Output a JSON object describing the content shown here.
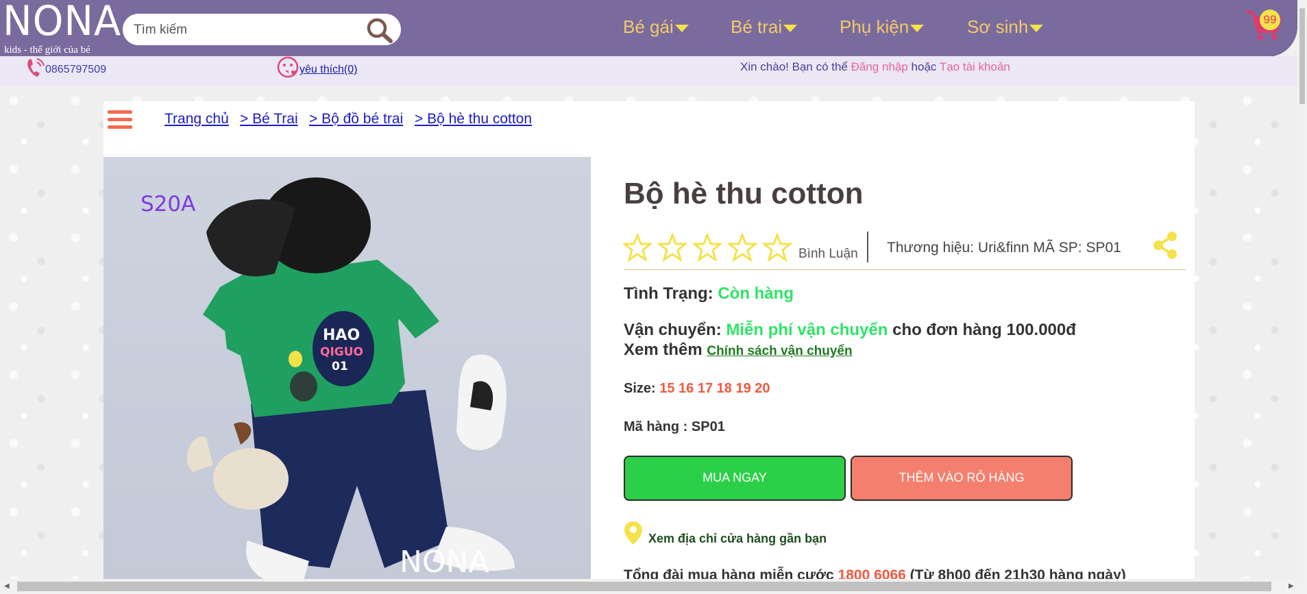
{
  "header": {
    "logo": "NONA",
    "tagline": "kids - thế giới của bé",
    "search_placeholder": "Tìm kiếm",
    "nav": [
      "Bé gái",
      "Bé trai",
      "Phụ kiện",
      "Sơ sinh"
    ],
    "cart_count": "99"
  },
  "subbar": {
    "phone": "0865797509",
    "favorites": "yêu thích(0)",
    "greeting_prefix": "Xin chào! Bạn có thể",
    "login": "Đăng nhập",
    "or": "hoặc",
    "register": "Tạo tài khoản"
  },
  "breadcrumb": [
    "Trang chủ",
    "> Bé Trai",
    "> Bộ đồ bé trai",
    "> Bộ hè thu cotton"
  ],
  "image": {
    "code_label": "S20A",
    "watermark": "NONA",
    "print_lines": [
      "HAO",
      "QIGUO",
      "01"
    ]
  },
  "product": {
    "title": "Bộ hè thu cotton",
    "rating_stars": 5,
    "rating_filled": 0,
    "review_label": "Bình Luận",
    "brand_line": "Thương hiệu: Uri&finn MÃ SP: SP01",
    "status_label": "Tình Trạng:",
    "status_value": "Còn hàng",
    "shipping_label": "Vận chuyển:",
    "shipping_value": "Miễn phí vận chuyển",
    "shipping_suffix": "cho đơn hàng 100.000đ",
    "see_more": "Xem thêm",
    "policy_link": "Chính sách vận chuyển",
    "size_label": "Size:",
    "sizes": "15 16 17 18 19 20",
    "sku_line": "Mã hàng : SP01",
    "buy_now": "MUA NGAY",
    "add_to_cart": "THÊM VÀO RỎ HÀNG",
    "store_locator": "Xem địa chỉ cửa hàng gần bạn",
    "hotline_prefix": "Tổng đài mua hàng miễn cước",
    "hotline_number": "1800 6066",
    "hotline_suffix": "(Từ 8h00 đến 21h30 hàng ngày)"
  },
  "colors": {
    "header_bg": "#7a6b9e",
    "nav_text": "#f4c96b",
    "accent_green": "#2ee565",
    "accent_red": "#f2583e",
    "buy_button": "#2ccf48",
    "cart_button": "#f47f6e"
  }
}
